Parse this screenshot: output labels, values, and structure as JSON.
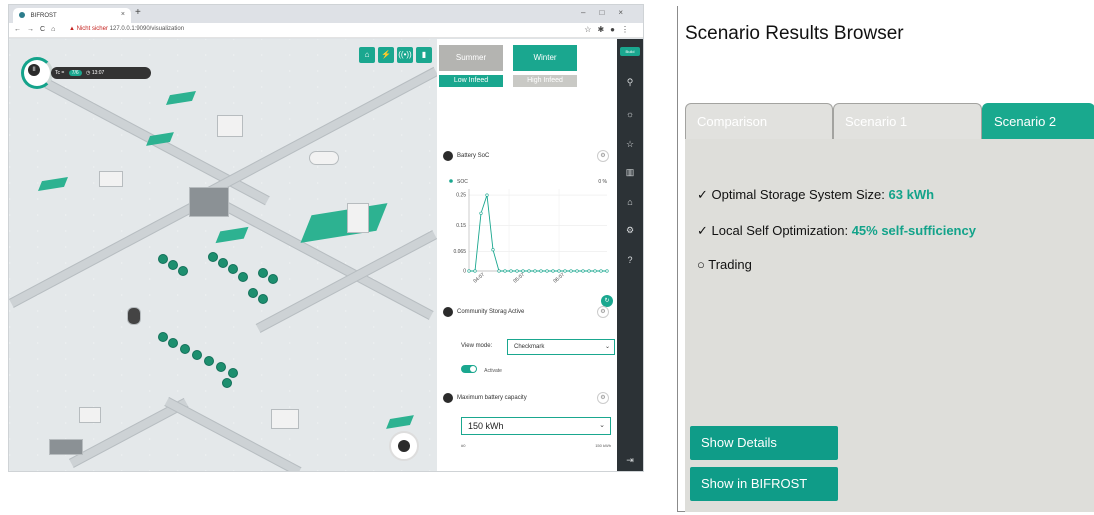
{
  "browser": {
    "tab_title": "BIFROST",
    "url_warning": "Nicht sicher",
    "url": "127.0.0.1:9090/visualization"
  },
  "map": {
    "time_pill": {
      "label_prefix": "Tc =",
      "chip1": "7/6",
      "time": "13:07"
    },
    "layer_buttons": [
      "⌂",
      "⚡",
      "((•))",
      "▮"
    ]
  },
  "panel": {
    "season_summer": "Summer",
    "season_winter": "Winter",
    "infeed_low": "Low Infeed",
    "infeed_high": "High Infeed",
    "battery_section": "Battery SoC",
    "chart_legend": "SOC",
    "chart_legend_value": "0 %",
    "community_section": "Community Storag Active",
    "view_mode_label": "View mode:",
    "view_mode_value": "Checkmark",
    "activate_label": "Activate",
    "capacity_section": "Maximum battery capacity",
    "capacity_value": "150 kWh",
    "capacity_foot_left": "#0",
    "capacity_foot_right": "150 kWh"
  },
  "sidebar": {
    "build_label": "Build"
  },
  "chart_data": {
    "type": "line",
    "title": "Battery SoC",
    "series": [
      {
        "name": "SOC",
        "x": [
          0,
          1,
          2,
          3,
          4,
          5,
          6,
          7,
          8,
          9,
          10,
          11,
          12,
          13,
          14,
          15,
          16,
          17,
          18,
          19,
          20,
          21,
          22,
          23
        ],
        "values": [
          0,
          0,
          0.19,
          0.25,
          0.07,
          0,
          0,
          0,
          0,
          0,
          0,
          0,
          0,
          0,
          0,
          0,
          0,
          0,
          0,
          0,
          0,
          0,
          0,
          0
        ]
      }
    ],
    "yticks": [
      "0.25",
      "0.15",
      "0.065",
      "0"
    ],
    "xticks": [
      "04:07",
      "05:07",
      "06:07"
    ],
    "ylim": [
      0,
      0.27
    ],
    "grid": true,
    "color": "#1aa78f"
  },
  "srb": {
    "title": "Scenario Results Browser",
    "tabs": [
      "Comparison",
      "Scenario 1",
      "Scenario 2"
    ],
    "active_tab": "Scenario 2",
    "results": [
      {
        "prefix": "✓ Optimal Storage System Size: ",
        "highlight": "63 kWh"
      },
      {
        "prefix": "✓ Local Self Optimization: ",
        "highlight": "45% self-sufficiency"
      },
      {
        "prefix": "○ Trading",
        "highlight": ""
      }
    ],
    "buttons": {
      "details": "Show Details",
      "bifrost": "Show in BIFROST"
    },
    "accent": "#19a98e"
  }
}
